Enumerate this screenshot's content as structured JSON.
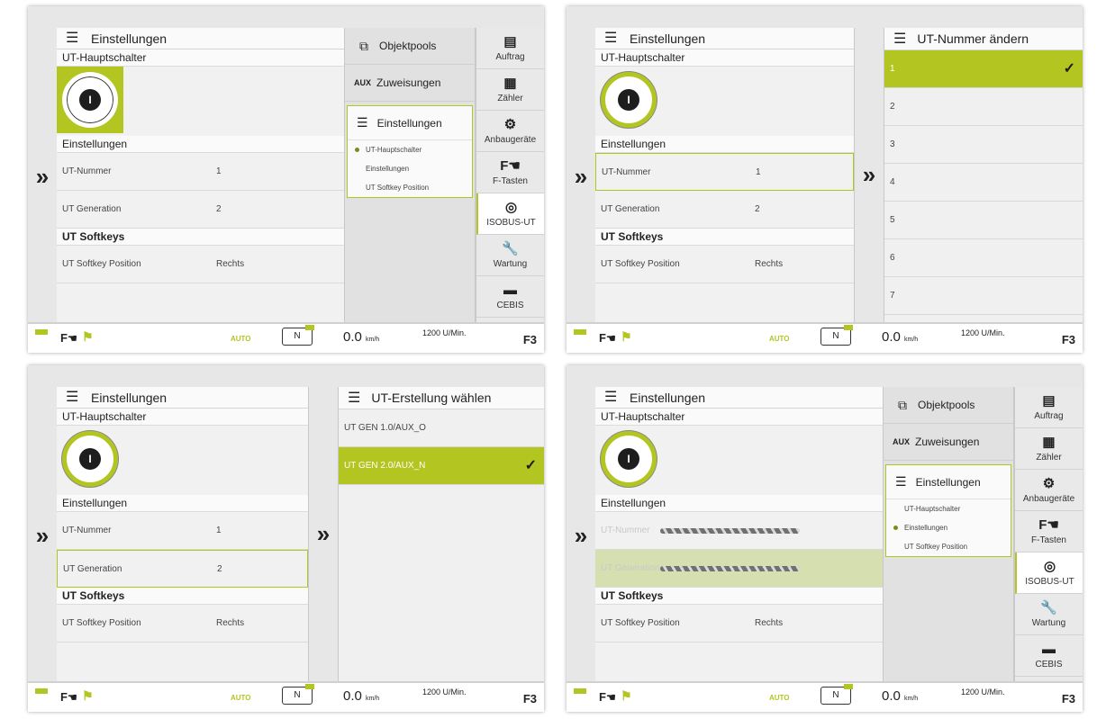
{
  "screens": [
    {
      "settings_title": "Einstellungen",
      "section_main_switch": "UT-Hauptschalter",
      "section_settings": "Einstellungen",
      "row_ut_number_label": "UT-Nummer",
      "row_ut_number_value": "1",
      "row_ut_generation_label": "UT Generation",
      "row_ut_generation_value": "2",
      "section_softkeys": "UT Softkeys",
      "row_softkey_label": "UT Softkey Position",
      "row_softkey_value": "Rechts",
      "switch_glyph": "I",
      "menu": {
        "objektpools": "Objektpools",
        "aux_tag": "AUX",
        "zuweisungen": "Zuweisungen",
        "einstellungen": "Einstellungen",
        "sub": [
          "UT-Hauptschalter",
          "Einstellungen",
          "UT Softkey Position"
        ]
      },
      "nav": [
        "Auftrag",
        "Zähler",
        "Anbaugeräte",
        "F-Tasten",
        "ISOBUS-UT",
        "Wartung",
        "CEBIS"
      ]
    },
    {
      "list_title": "UT-Nummer ändern",
      "list_items": [
        "1",
        "2",
        "3",
        "4",
        "5",
        "6",
        "7"
      ]
    },
    {
      "list_title": "UT-Erstellung wählen",
      "list_items": [
        "UT GEN 1.0/AUX_O",
        "UT GEN 2.0/AUX_N"
      ]
    }
  ],
  "status": {
    "ftasten": "F",
    "auto": "AUTO",
    "gear": "N",
    "speed": "0.0",
    "speed_unit": "km/h",
    "rpm1": "1200 U/Min.",
    "f3": "F3"
  },
  "colors": {
    "accent": "#b3c520",
    "panel": "#e7e7e7"
  }
}
